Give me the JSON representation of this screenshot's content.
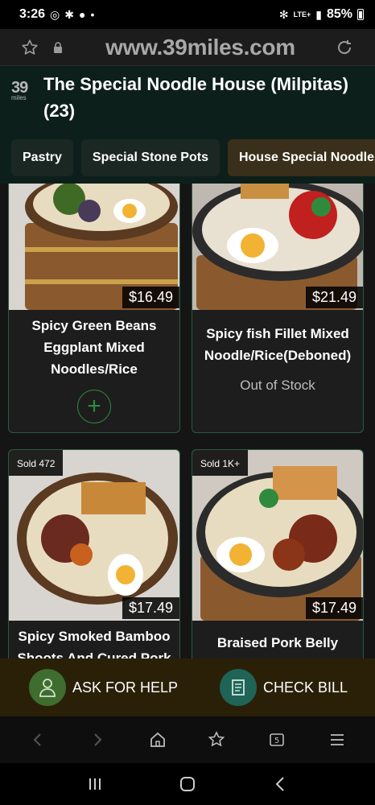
{
  "status_bar": {
    "time": "3:26",
    "battery": "85%",
    "network": "LTE+"
  },
  "browser": {
    "url": "www.39miles.com"
  },
  "header": {
    "logo_number": "39",
    "logo_sub": "miles",
    "title": "The Special Noodle House (Milpitas) (23)"
  },
  "tabs": [
    {
      "label": "Pastry",
      "active": false
    },
    {
      "label": "Special Stone Pots",
      "active": false
    },
    {
      "label": "House Special Noodles & Rice",
      "active": true
    }
  ],
  "menu_items": [
    {
      "name": "Spicy Green Beans Eggplant Mixed Noodles/Rice",
      "price": "$16.49",
      "sold": "",
      "status": "add"
    },
    {
      "name": "Spicy fish Fillet Mixed Noodle/Rice(Deboned)",
      "price": "$21.49",
      "sold": "",
      "status": "Out of Stock"
    },
    {
      "name": "Spicy Smoked Bamboo Shoots And Cured Pork",
      "price": "$17.49",
      "sold": "Sold 472",
      "status": ""
    },
    {
      "name": "Braised Pork Belly Mixed",
      "price": "$17.49",
      "sold": "Sold 1K+",
      "status": ""
    }
  ],
  "actions": {
    "help_label": "ASK FOR HELP",
    "bill_label": "CHECK BILL"
  },
  "browser_nav": {
    "tab_count": "5"
  },
  "colors": {
    "header_bg": "#0d1f1a",
    "accent_green": "#2f8a3e",
    "card_border": "#2b5a3f",
    "action_bar_bg": "#2a2008"
  },
  "icons": [
    "star-icon",
    "lock-icon",
    "reload-icon",
    "plus-icon",
    "help-person-icon",
    "bill-icon",
    "back-icon",
    "forward-icon",
    "home-icon",
    "bookmarks-icon",
    "tabs-icon",
    "menu-icon"
  ]
}
